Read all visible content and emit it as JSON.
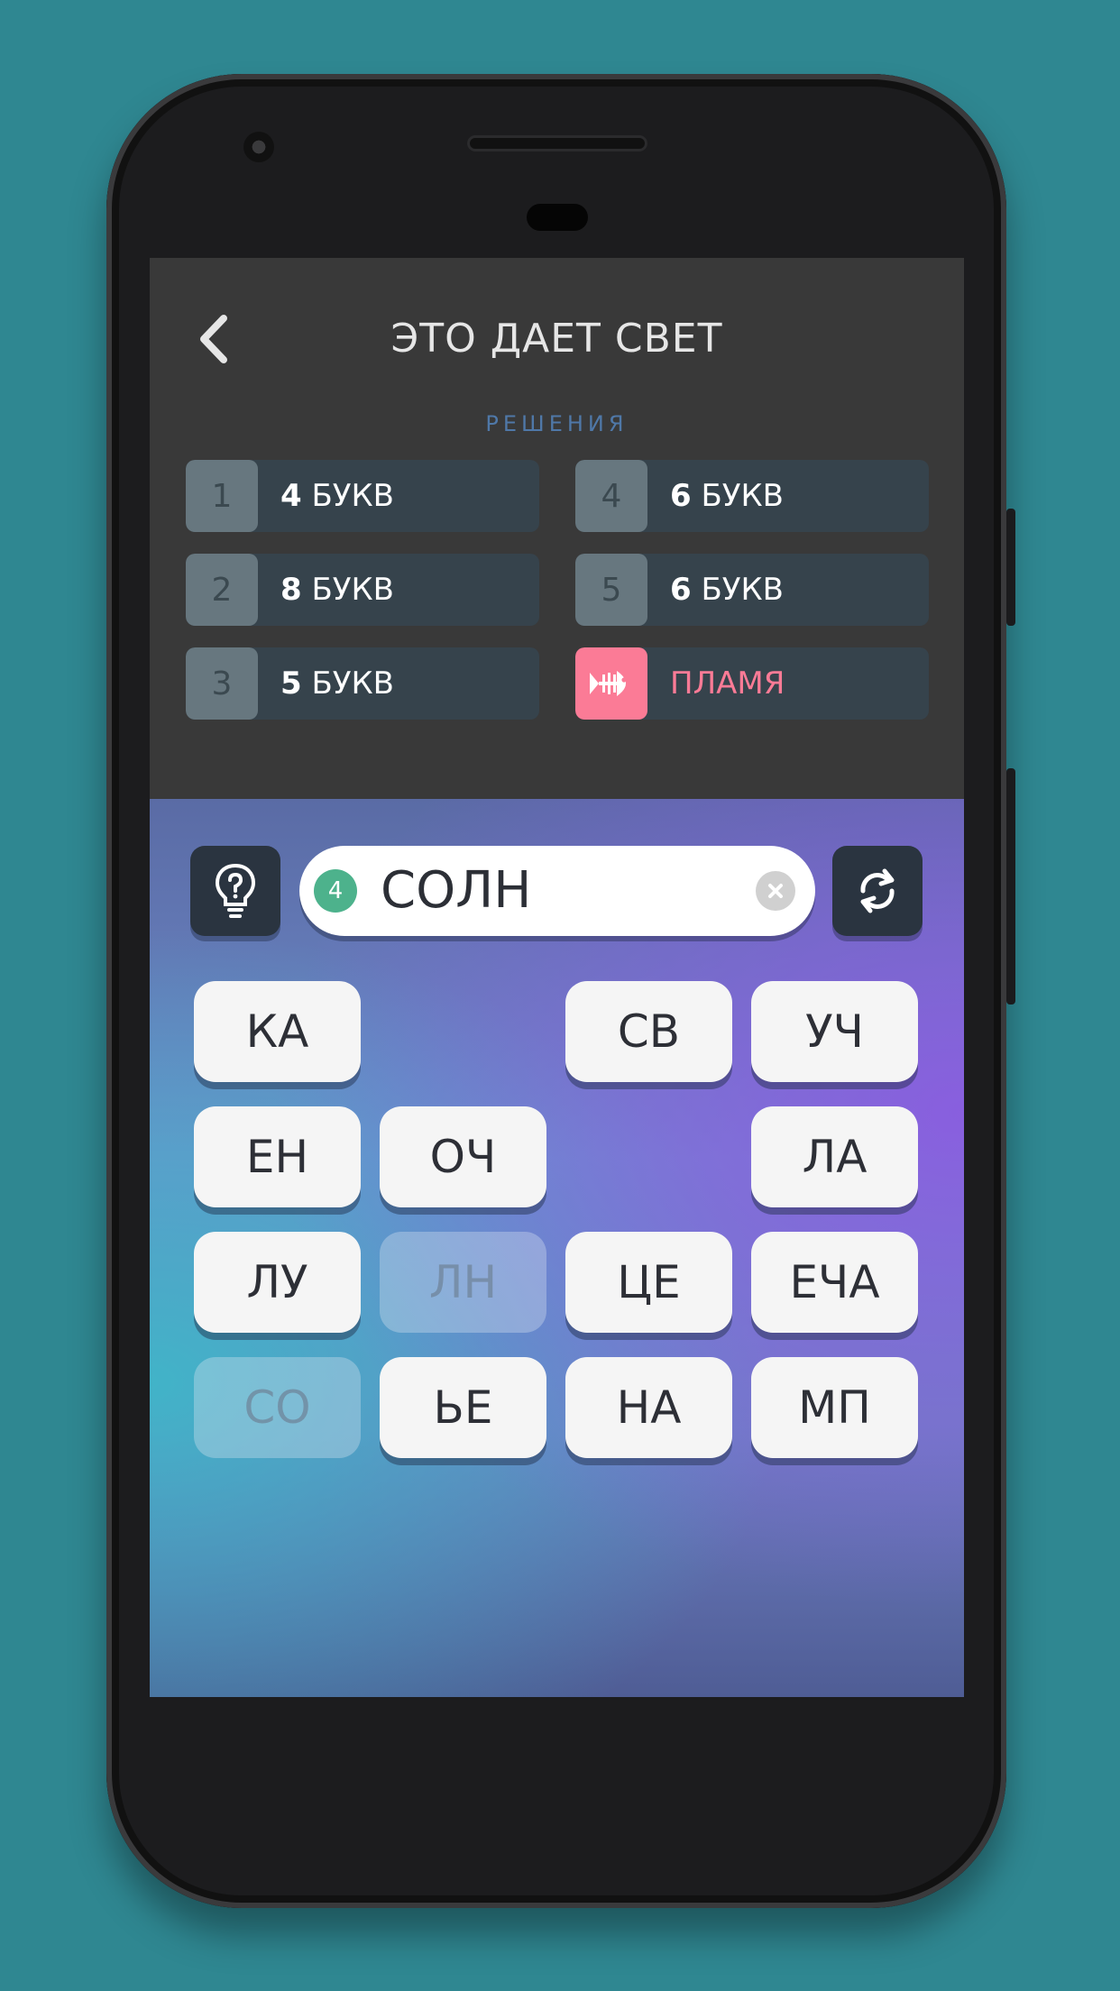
{
  "header": {
    "title": "ЭТО ДАЕТ СВЕТ",
    "solutions_label": "РЕШЕНИЯ"
  },
  "solutions": [
    {
      "num": "1",
      "count": "4",
      "unit": "БУКВ"
    },
    {
      "num": "2",
      "count": "8",
      "unit": "БУКВ"
    },
    {
      "num": "3",
      "count": "5",
      "unit": "БУКВ"
    },
    {
      "num": "4",
      "count": "6",
      "unit": "БУКВ"
    },
    {
      "num": "5",
      "count": "6",
      "unit": "БУКВ"
    }
  ],
  "hint_slot": {
    "icon": "fishbone-icon",
    "text": "ПЛАМЯ",
    "color": "#fb7b96"
  },
  "input": {
    "length_badge": "4",
    "value": "СОЛН"
  },
  "tiles": [
    {
      "label": "КА",
      "used": false
    },
    {
      "label": "СВ",
      "used": false
    },
    {
      "label": "УЧ",
      "used": false
    },
    {
      "label": "ЕН",
      "used": false
    },
    {
      "label": "ОЧ",
      "used": false
    },
    {
      "label": "ЛА",
      "used": false
    },
    {
      "label": "ЛУ",
      "used": false
    },
    {
      "label": "ЛН",
      "used": true
    },
    {
      "label": "ЦЕ",
      "used": false
    },
    {
      "label": "ЕЧА",
      "used": false
    },
    {
      "label": "СО",
      "used": true
    },
    {
      "label": "ЬЕ",
      "used": false
    },
    {
      "label": "НА",
      "used": false
    },
    {
      "label": "МП",
      "used": false
    }
  ],
  "colors": {
    "background": "#2f8791",
    "accent_green": "#4db28c",
    "hint_pink": "#fb7b96"
  }
}
